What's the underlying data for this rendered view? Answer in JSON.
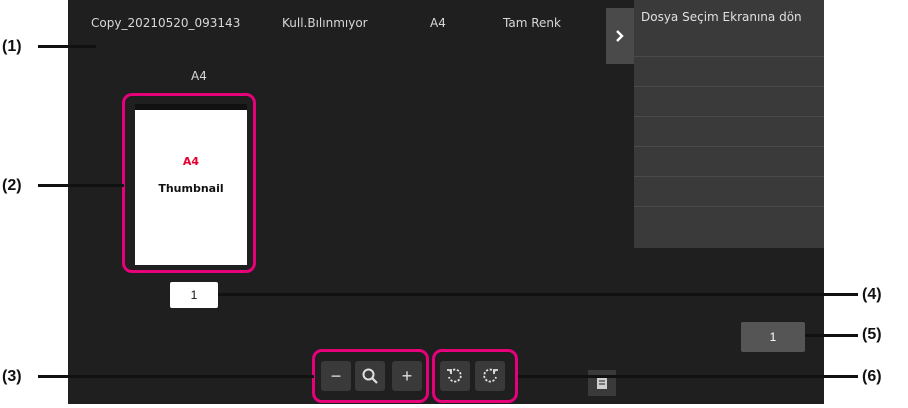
{
  "header": {
    "filename": "Copy_20210520_093143",
    "user": "Kull.Bılınmıyor",
    "paper": "A4",
    "color_mode": "Tam Renk"
  },
  "panel": {
    "title": "Dosya Seçim Ekranına dön",
    "tab_icon": "chevron-right-icon"
  },
  "thumbnail": {
    "size_label": "A4",
    "page_size_text": "A4",
    "caption": "Thumbnail"
  },
  "page_indicator": "1",
  "total_pages": "1",
  "controls": {
    "zoom_out": "−",
    "zoom_in": "+"
  },
  "callouts": {
    "c1": "(1)",
    "c2": "(2)",
    "c3": "(3)",
    "c4": "(4)",
    "c5": "(5)",
    "c6": "(6)"
  },
  "colors": {
    "screen_bg": "#1f1f1f",
    "highlight": "#e6007a",
    "panel_bg": "#3a3a3a"
  }
}
